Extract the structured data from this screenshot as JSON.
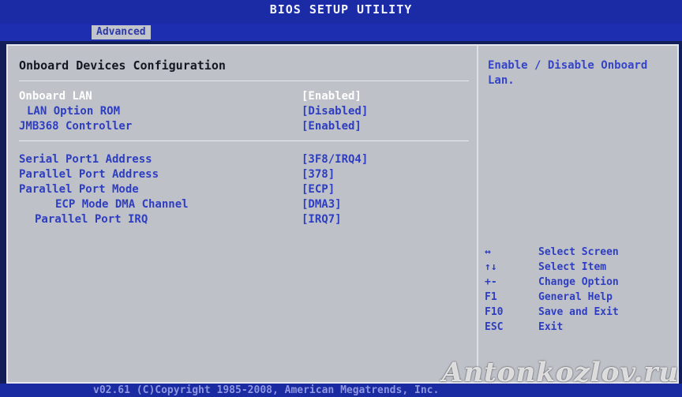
{
  "header": {
    "title": "BIOS SETUP UTILITY"
  },
  "tabs": [
    {
      "label": "Advanced"
    }
  ],
  "main": {
    "section_title": "Onboard Devices Configuration",
    "group1": [
      {
        "label": "Onboard LAN",
        "value": "[Enabled]",
        "selected": true
      },
      {
        "label": "LAN Option ROM",
        "value": "[Disabled]"
      },
      {
        "label": "JMB368 Controller",
        "value": "[Enabled]"
      }
    ],
    "group2": [
      {
        "label": "Serial Port1 Address",
        "value": "[3F8/IRQ4]"
      },
      {
        "label": "Parallel Port Address",
        "value": "[378]"
      },
      {
        "label": "Parallel Port Mode",
        "value": "[ECP]"
      },
      {
        "label": "ECP Mode DMA Channel",
        "value": "[DMA3]"
      },
      {
        "label": "Parallel Port IRQ",
        "value": "[IRQ7]"
      }
    ]
  },
  "help": {
    "text": "Enable / Disable Onboard Lan.",
    "keys": [
      {
        "key": "↔",
        "desc": "Select Screen"
      },
      {
        "key": "↑↓",
        "desc": "Select Item"
      },
      {
        "key": "+-",
        "desc": "Change Option"
      },
      {
        "key": "F1",
        "desc": "General Help"
      },
      {
        "key": "F10",
        "desc": "Save and Exit"
      },
      {
        "key": "ESC",
        "desc": "Exit"
      }
    ]
  },
  "footer": {
    "text": "v02.61 (C)Copyright 1985-2008, American Megatrends, Inc."
  },
  "watermark": "Antonkozlov.ru",
  "colors": {
    "title_bar": "#1b2ba6",
    "panel": "#bfc1c9",
    "option_text": "#2e3ec0",
    "selected_text": "#ffffff"
  }
}
